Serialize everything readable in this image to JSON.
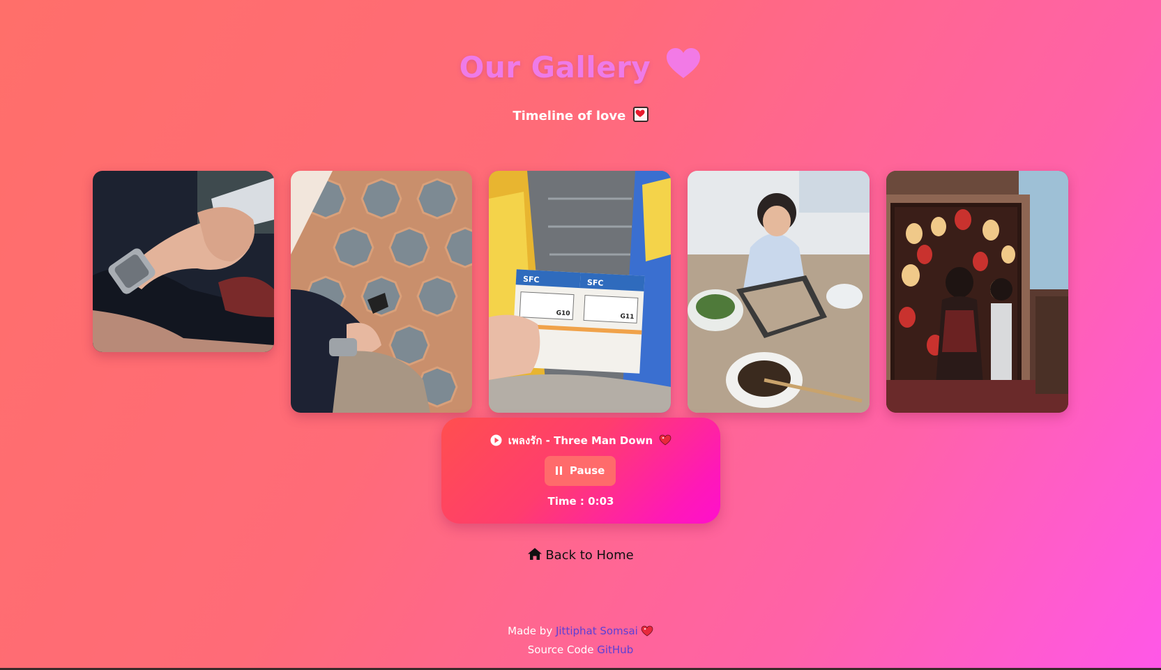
{
  "header": {
    "title": "Our Gallery",
    "title_icon": "heart-icon",
    "subtitle": "Timeline of love",
    "subtitle_icon": "love-letter-icon"
  },
  "gallery": {
    "photos": [
      {
        "name": "holding-hands-watch"
      },
      {
        "name": "holding-hands-tiles"
      },
      {
        "name": "cinema-tickets-escalator"
      },
      {
        "name": "hotpot-meal"
      },
      {
        "name": "mirror-selfie-lanterns"
      }
    ],
    "ticket_brand": "SFC",
    "ticket_seats": [
      "G10",
      "G11"
    ]
  },
  "player": {
    "song_title": "เพลงรัก - Three Man Down",
    "play_icon": "play-circle-icon",
    "song_icon": "heart-icon",
    "pause_label": "Pause",
    "pause_icon": "pause-icon",
    "time_text": "Time : 0:03"
  },
  "nav": {
    "home_label": "Back to Home",
    "home_icon": "house-icon"
  },
  "footer": {
    "made_by_prefix": "Made by ",
    "author": "Jittiphat Somsai",
    "source_prefix": "Source Code ",
    "source_link": "GitHub"
  },
  "colors": {
    "title": "#ee7be8",
    "link": "#5b3fd6",
    "button": "#ff6b6b"
  }
}
